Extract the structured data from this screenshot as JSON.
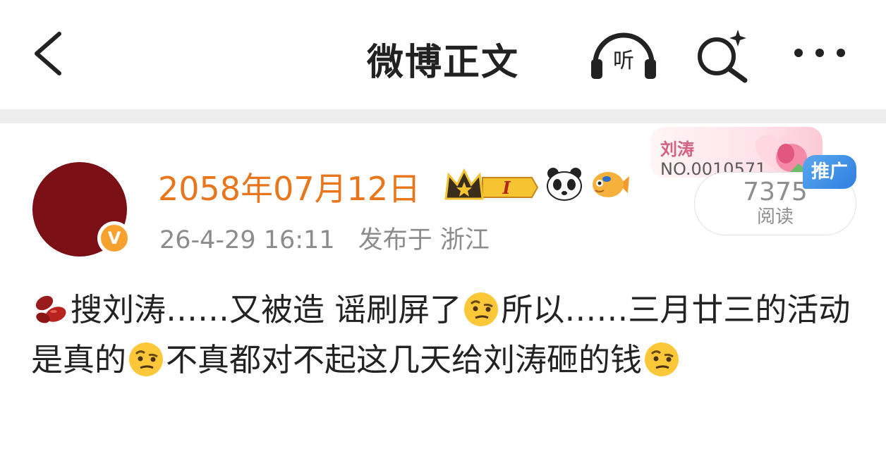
{
  "nav": {
    "title": "微博正文",
    "listen_label": "听",
    "icons": [
      "back-arrow-icon",
      "listen-icon",
      "ai-search-icon",
      "more-icon"
    ]
  },
  "author": {
    "name": "2058年07月12日",
    "badge_level": "I",
    "verified_mark": "V"
  },
  "meta": {
    "time": "26-4-29 16:11",
    "location": "发布于 浙江"
  },
  "promo": {
    "name": "刘涛",
    "number": "NO.0010571",
    "tag": "推广"
  },
  "reads": {
    "count": "7375",
    "label": "阅读"
  },
  "post": {
    "seg1": "搜刘涛……又被造 谣刷屏了",
    "seg2": "所以……三月廿三的活动是真的",
    "seg3": "不真都对不起这几天给刘涛砸的钱"
  },
  "colors": {
    "username": "#e8761c",
    "avatar": "#7b0f16",
    "verified": "#f7a12e",
    "promo_tag": "#2f7fe0"
  }
}
